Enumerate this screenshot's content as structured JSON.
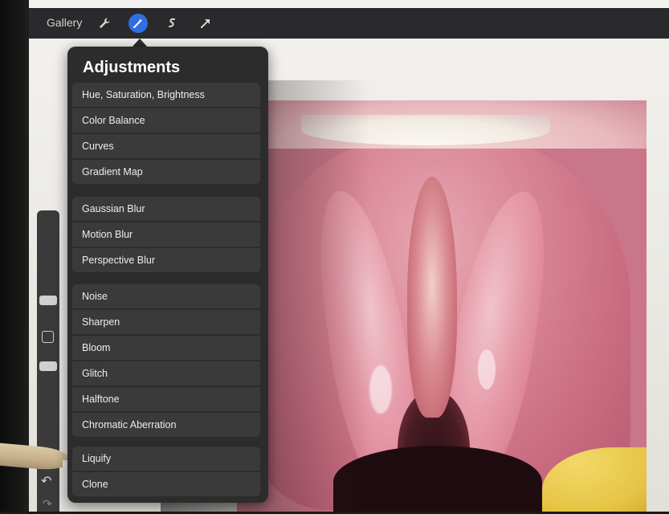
{
  "toolbar": {
    "gallery_label": "Gallery",
    "tools": [
      {
        "icon": "wrench-icon",
        "active": false
      },
      {
        "icon": "magic-wand-icon",
        "active": true
      },
      {
        "icon": "selection-icon",
        "active": false
      },
      {
        "icon": "transform-arrow-icon",
        "active": false
      }
    ],
    "accent_color": "#2f6fe4"
  },
  "adjustments": {
    "title": "Adjustments",
    "groups": [
      [
        "Hue, Saturation, Brightness",
        "Color Balance",
        "Curves",
        "Gradient Map"
      ],
      [
        "Gaussian Blur",
        "Motion Blur",
        "Perspective Blur"
      ],
      [
        "Noise",
        "Sharpen",
        "Bloom",
        "Glitch",
        "Halftone",
        "Chromatic Aberration"
      ],
      [
        "Liquify",
        "Clone"
      ]
    ]
  },
  "sidebar": {
    "undo_icon": "undo-icon",
    "redo_icon": "redo-icon",
    "modify_icon": "modify-square-icon"
  }
}
